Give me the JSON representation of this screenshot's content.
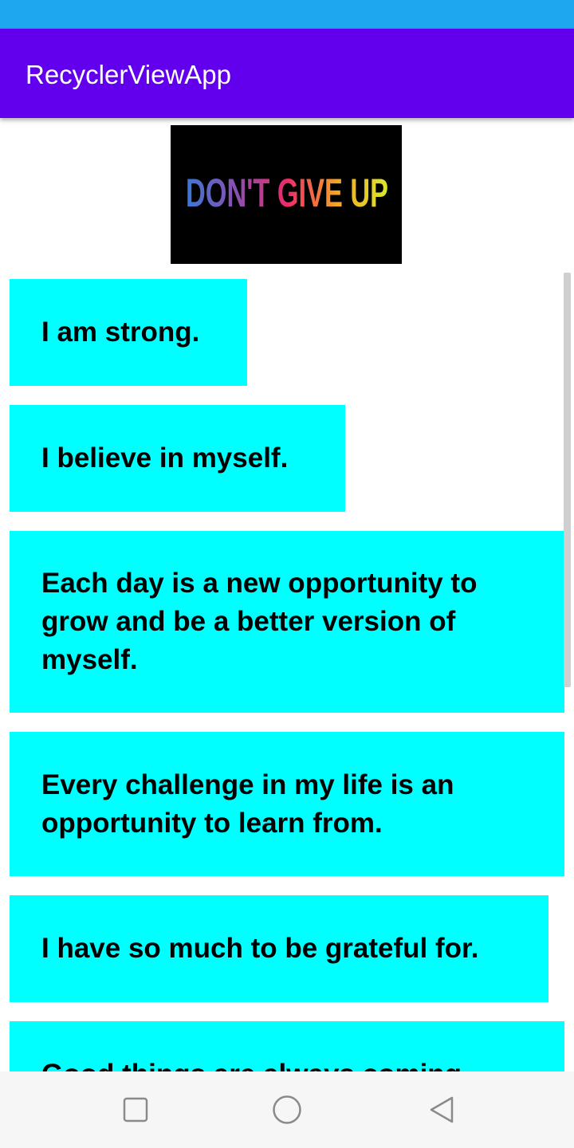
{
  "app": {
    "title": "RecyclerViewApp"
  },
  "banner": {
    "text": "DON'T GIVE UP"
  },
  "affirmations": [
    "I am strong.",
    "I believe in myself.",
    "Each day is a new opportunity to grow and be a better version of myself.",
    "Every challenge in my life is an opportunity to learn from.",
    "I have so much to be grateful for.",
    "Good things are always coming"
  ],
  "colors": {
    "status_bar": "#1ea7ee",
    "app_bar": "#6200ee",
    "card": "#00ffff",
    "nav_bar": "#f6f6f6"
  },
  "nav": {
    "icons": [
      "square-icon",
      "circle-icon",
      "triangle-back-icon"
    ]
  }
}
